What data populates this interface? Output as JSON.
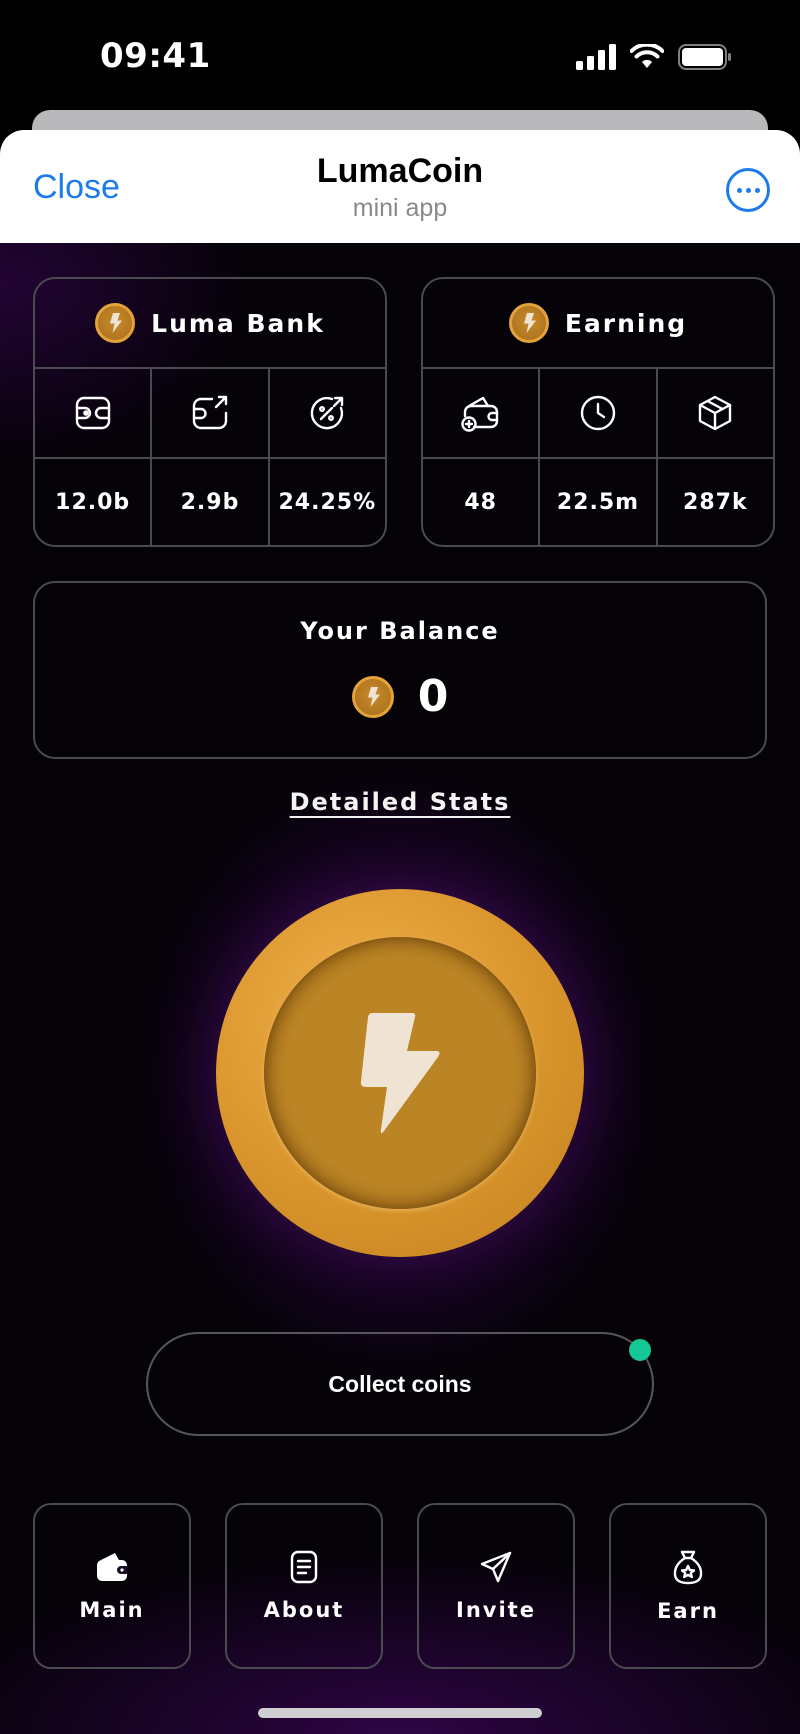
{
  "status_bar": {
    "time": "09:41"
  },
  "header": {
    "close_label": "Close",
    "title": "LumaCoin",
    "subtitle": "mini app"
  },
  "bank_card": {
    "title": "Luma Bank",
    "icons": [
      "wallet-icon",
      "wallet-export-icon",
      "discount-percent-icon"
    ],
    "values": [
      "12.0b",
      "2.9b",
      "24.25%"
    ]
  },
  "earning_card": {
    "title": "Earning",
    "icons": [
      "wallet-add-icon",
      "clock-icon",
      "box-icon"
    ],
    "values": [
      "48",
      "22.5m",
      "287k"
    ]
  },
  "balance": {
    "label": "Your Balance",
    "value": "0"
  },
  "stats_link": "Detailed Stats",
  "collect_button": "Collect coins",
  "nav": [
    {
      "label": "Main",
      "icon": "wallet-icon"
    },
    {
      "label": "About",
      "icon": "document-icon"
    },
    {
      "label": "Invite",
      "icon": "send-icon"
    },
    {
      "label": "Earn",
      "icon": "star-bag-icon"
    }
  ],
  "colors": {
    "accent_blue": "#1d7bea",
    "coin_gold": "#d9952c",
    "status_green": "#14c995",
    "bolt": "#efe4d4"
  }
}
